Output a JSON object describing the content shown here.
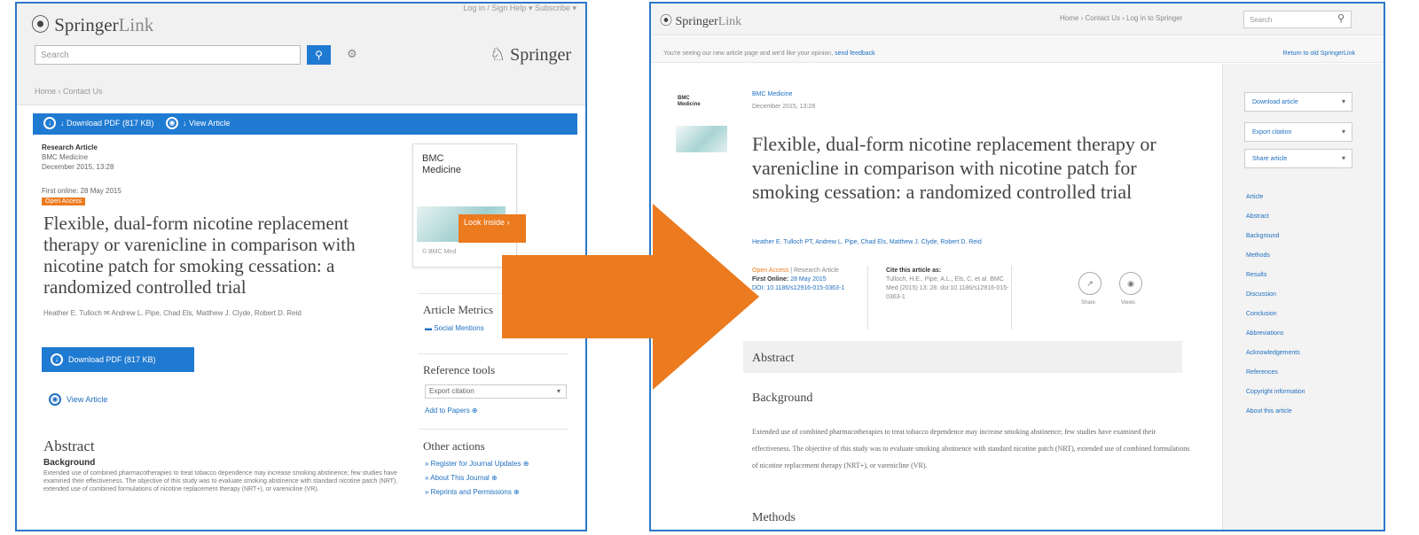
{
  "left": {
    "logo": {
      "brand": "Springer",
      "suffix": "Link"
    },
    "top_links": "Log in / Sign   Help ▾   Subscribe ▾",
    "search_placeholder": "Search",
    "springer_logo": "Springer",
    "breadcrumb": "Home  ›  Contact Us",
    "toolbar": {
      "download_pdf": "↓ Download PDF (817 KB)",
      "view_article": "↓ View Article"
    },
    "meta": {
      "type": "Research Article",
      "journal": "BMC Medicine",
      "date": "December 2015, 13:28",
      "first_online": "First online: 28 May 2015",
      "badge": "Open Access"
    },
    "title": "Flexible, dual-form nicotine replacement therapy or varenicline in comparison with nicotine patch for smoking cessation: a randomized controlled trial",
    "authors": "Heather E. Tulloch  ✉   Andrew L. Pipe, Chad Els, Matthew J. Clyde, Robert D. Reid",
    "download_pdf_button": "Download PDF (817 KB)",
    "view_article_link": "View Article",
    "abstract_heading": "Abstract",
    "background_heading": "Background",
    "abstract_text": "Extended use of combined pharmacotherapies to treat tobacco dependence may increase smoking abstinence; few studies have examined their effectiveness. The objective of this study was to evaluate smoking abstinence with standard nicotine patch (NRT), extended use of combined formulations of nicotine replacement therapy (NRT+), or varenicline (VR).",
    "journal_card": {
      "name": "BMC Medicine",
      "small": "© BMC Med",
      "look_inside": "Look Inside ›"
    },
    "article_metrics": {
      "heading": "Article Metrics",
      "link": "Social Mentions"
    },
    "reference_tools": {
      "heading": "Reference tools",
      "select": "Export citation",
      "link": "Add to Papers ⊕"
    },
    "other_actions": {
      "heading": "Other actions",
      "links": [
        "» Register for Journal Updates ⊕",
        "» About This Journal ⊕",
        "» Reprints and Permissions ⊕"
      ]
    }
  },
  "right": {
    "logo": {
      "brand": "Springer",
      "suffix": "Link"
    },
    "nav": "Home  ›  Contact Us  ›  Log in to Springer",
    "search_placeholder": "Search",
    "notice": {
      "text": "You're seeing our new article page and we'd like your opinion,",
      "link": "send feedback",
      "right_link": "Return to old SpringerLink"
    },
    "thumb_label": "BMC Medicine",
    "journal": "BMC Medicine",
    "date": "December 2015, 13:28",
    "title": "Flexible, dual-form nicotine replacement therapy or varenicline in comparison with nicotine patch for smoking cessation: a randomized controlled trial",
    "authors": "Heather E. Tulloch PT, Andrew L. Pipe, Chad Els, Matthew J. Clyde, Robert D. Reid",
    "info": {
      "badge": "Open Access",
      "type": "Research Article",
      "first_online_label": "First Online:",
      "first_online": "28 May 2015",
      "doi": "DOI: 10.1186/s12916-015-0363-1"
    },
    "cite": {
      "heading": "Cite this article as:",
      "line1": "Tulloch, H.E., Pipe, A.L., Els, C. et al. BMC",
      "line2": "Med (2015) 13: 28. doi:10.1186/s12916-015-",
      "line3": "0363-1"
    },
    "share_label": "Share",
    "views_label": "Views",
    "abstract_heading": "Abstract",
    "background_heading": "Background",
    "abstract_text": "Extended use of combined pharmacotherapies to treat tobacco dependence may increase smoking abstinence; few studies have examined their effectiveness. The objective of this study was to evaluate smoking abstinence with standard nicotine patch (NRT), extended use of combined formulations of nicotine replacement therapy (NRT+), or varenicline (VR).",
    "methods_heading": "Methods",
    "sidebar": {
      "dropdowns": [
        "Download article",
        "Export citation",
        "Share article"
      ],
      "toc": [
        "Article",
        "Abstract",
        "Background",
        "Methods",
        "Results",
        "Discussion",
        "Conclusion",
        "Abbreviations",
        "Acknowledgements",
        "References",
        "Copyright information",
        "About this article"
      ]
    }
  },
  "colors": {
    "accent_blue": "#1f7ad2",
    "orange": "#ec7a1e",
    "frame_blue": "#2c78c9"
  }
}
